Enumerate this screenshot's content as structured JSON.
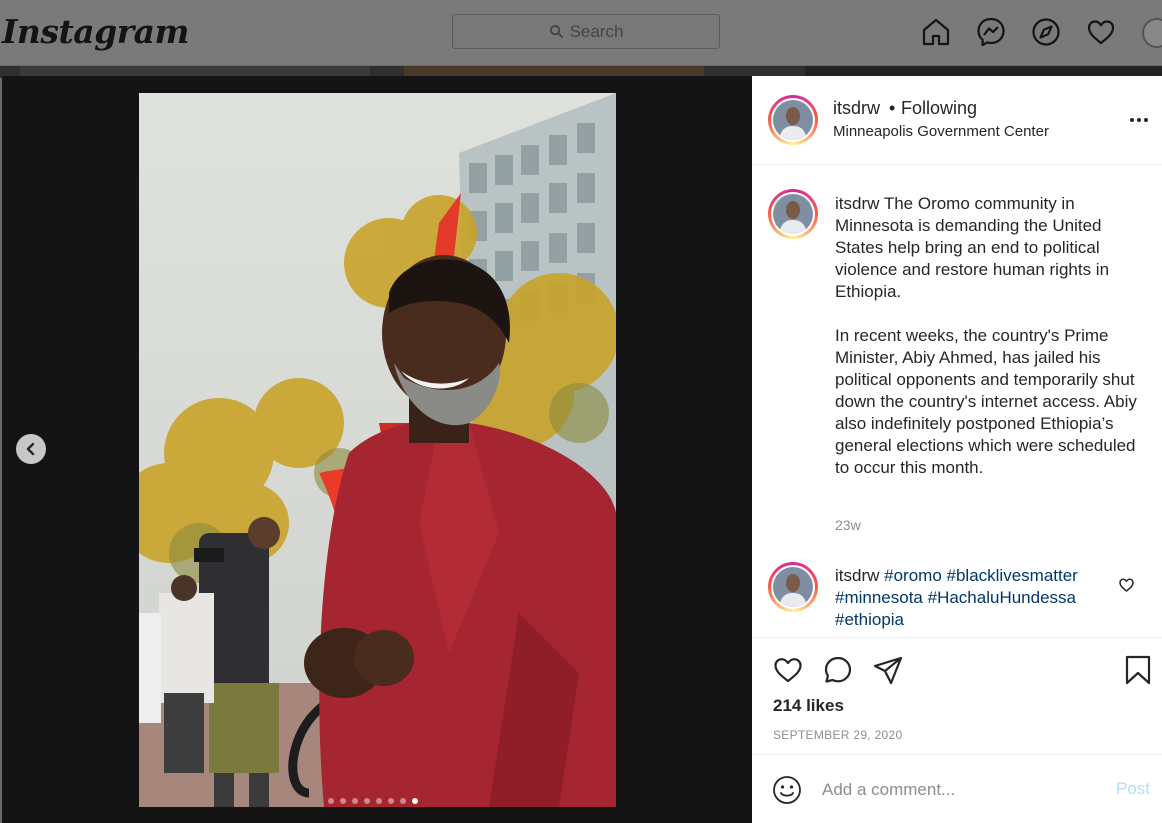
{
  "header": {
    "logo": "Instagram",
    "search_placeholder": "Search"
  },
  "post": {
    "username": "itsdrw",
    "separator": "•",
    "follow_status": "Following",
    "location": "Minneapolis Government Center",
    "caption": "The Oromo community in Minnesota is demanding the United States help bring an end to political violence and restore human rights in Ethiopia.\n\nIn recent weeks, the country's Prime Minister, Abiy Ahmed, has jailed his political opponents and temporarily shut down the country's internet access. Abiy also indefinitely postponed Ethiopia’s general elections which were scheduled to occur this month.",
    "caption_age": "23w",
    "comment": {
      "username": "itsdrw",
      "hashtags": [
        "#oromo",
        "#blacklivesmatter",
        "#minnesota",
        "#HachaluHundessa",
        "#ethiopia"
      ]
    },
    "likes": "214 likes",
    "date": "SEPTEMBER 29, 2020",
    "carousel": {
      "total": 8,
      "active_index": 7
    }
  },
  "comment_box": {
    "placeholder": "Add a comment...",
    "post_label": "Post"
  },
  "colors": {
    "hashtag": "#00376b",
    "post_disabled": "#b2dffc",
    "secondary_text": "#8e8e8e"
  }
}
